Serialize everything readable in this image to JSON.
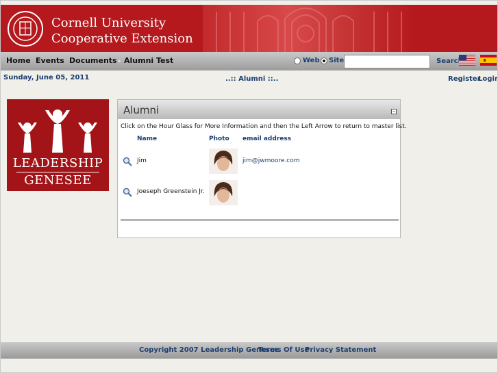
{
  "header": {
    "org_line1": "Cornell University",
    "org_line2": "Cooperative Extension",
    "seal_icon": "cornell-seal-icon"
  },
  "nav": {
    "items": [
      "Home",
      "Events",
      "Documents",
      "Alumni",
      "Test"
    ],
    "search": {
      "option_web": "Web",
      "option_site": "Site",
      "selected": "Site",
      "value": "",
      "label": "Search"
    },
    "flags": [
      "us-flag-icon",
      "spain-flag-icon"
    ]
  },
  "info": {
    "date": "Sunday, June 05, 2011",
    "breadcrumb": "..:: Alumni ::..",
    "register": "Register",
    "login": "Login"
  },
  "logo": {
    "word1": "LEADERSHIP",
    "word2": "GENESEE"
  },
  "panel": {
    "title": "Alumni",
    "instructions": "Click on the Hour Glass for More Information and then the Left Arrow to return to master list.",
    "columns": [
      "Name",
      "Photo",
      "email address"
    ],
    "rows": [
      {
        "name": "Jim",
        "email": "jim@jwmoore.com"
      },
      {
        "name": "Joeseph Greenstein Jr.",
        "email": ""
      }
    ]
  },
  "footer": {
    "copyright": "Copyright 2007 Leadership Genesee",
    "terms": "Terms Of Use",
    "privacy": "Privacy Statement"
  },
  "colors": {
    "header_red": "#b5181d",
    "link_blue": "#1c3e6e",
    "logo_red": "#a31419"
  }
}
